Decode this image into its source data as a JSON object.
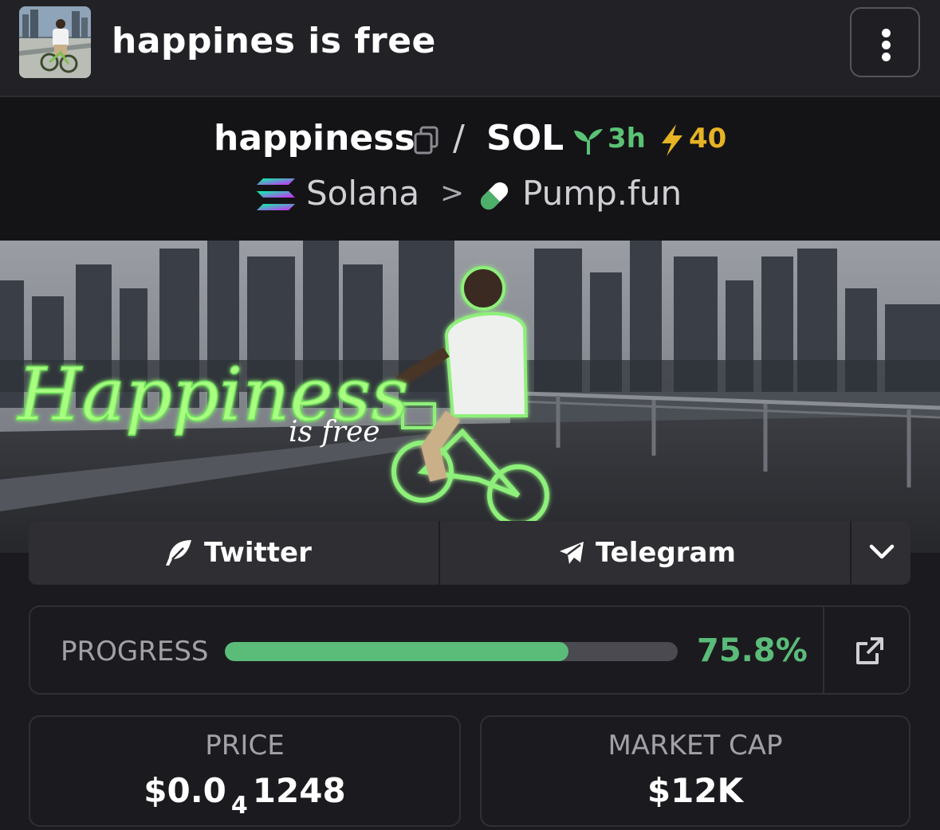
{
  "header": {
    "title": "happines is free",
    "avatar_alt": "token avatar",
    "menu_icon": "kebab-menu-icon"
  },
  "pair": {
    "base": "happiness",
    "separator": "/",
    "quote": "SOL",
    "age": "3h",
    "boosts": "40",
    "chain": "Solana",
    "breadcrumb_sep": ">",
    "dex": "Pump.fun"
  },
  "banner": {
    "headline": "Happiness",
    "tagline": "is free"
  },
  "socials": {
    "twitter": "Twitter",
    "telegram": "Telegram"
  },
  "progress": {
    "label": "PROGRESS",
    "value_text": "75.8%",
    "fraction": 0.758
  },
  "stats": {
    "price_label": "PRICE",
    "price_prefix": "$0.0",
    "price_zeros": "4",
    "price_digits": "1248",
    "mcap_label": "MARKET CAP",
    "mcap_value": "$12K"
  },
  "colors": {
    "accent_green": "#5bbc79",
    "boost_yellow": "#e6b325",
    "background": "#1b1b1f"
  }
}
